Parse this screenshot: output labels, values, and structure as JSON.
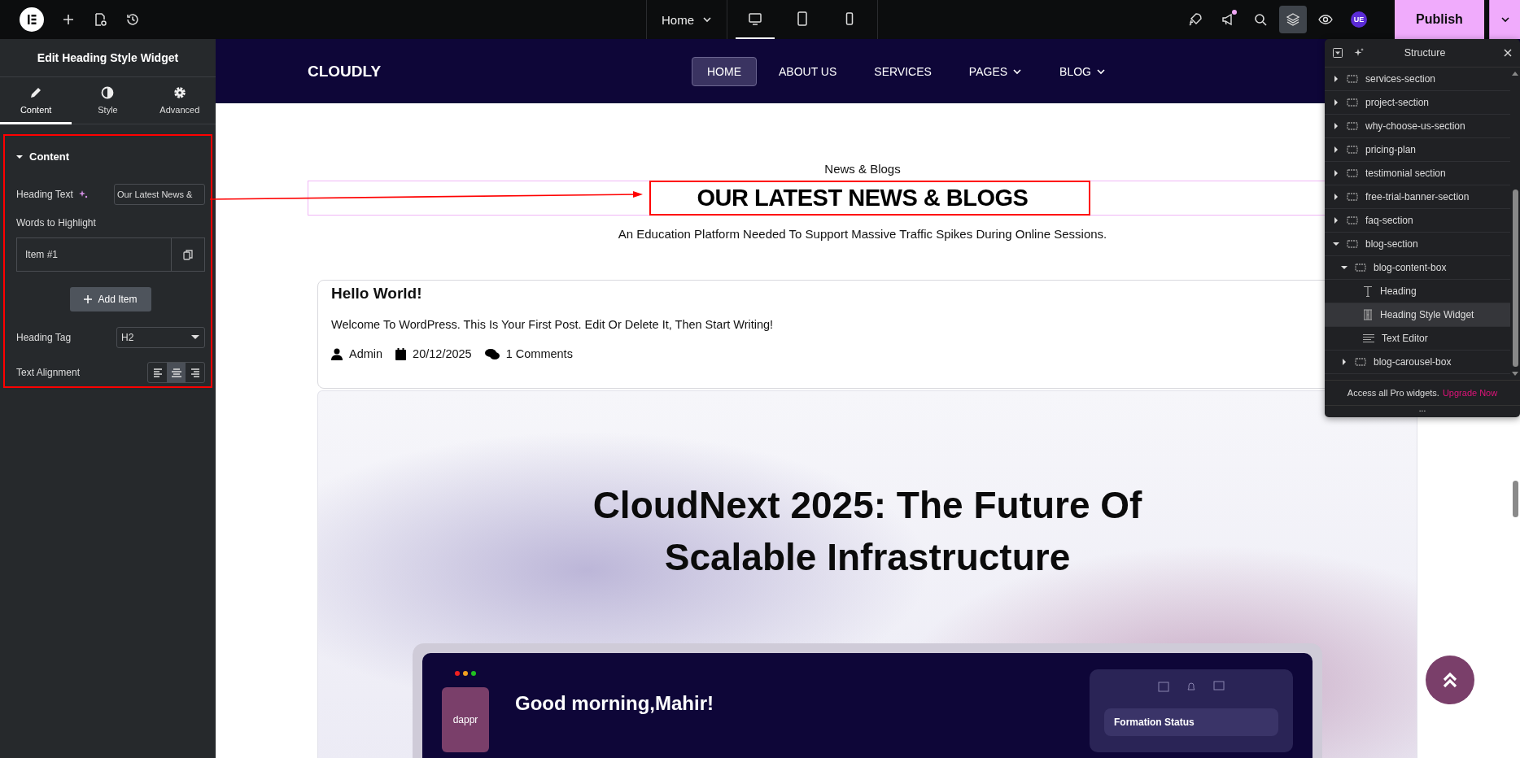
{
  "topbar": {
    "page_selector": "Home",
    "devices": [
      {
        "kind": "desktop",
        "selected": true
      },
      {
        "kind": "tablet",
        "selected": false
      },
      {
        "kind": "mobile",
        "selected": false
      }
    ],
    "notification": true,
    "layers_active": true,
    "user_badge": "UE",
    "publish": "Publish"
  },
  "panel": {
    "title": "Edit Heading Style Widget",
    "tabs": [
      {
        "kind": "pencil",
        "label": "Content",
        "selected": true
      },
      {
        "kind": "contrast",
        "label": "Style",
        "selected": false
      },
      {
        "kind": "gear",
        "label": "Advanced",
        "selected": false
      }
    ],
    "section": {
      "title": "Content",
      "expanded": true
    },
    "controls": [
      {
        "kind": "text",
        "label": "Heading Text",
        "value": "Our Latest News &"
      },
      {
        "kind": "repeater",
        "label": "Words to Highlight",
        "items": [
          "Item #1"
        ]
      },
      {
        "kind": "button",
        "label": "Add Item"
      },
      {
        "kind": "select",
        "label": "Heading Tag",
        "value": "H2"
      },
      {
        "kind": "alignment",
        "label": "Text Alignment",
        "options": [
          {
            "kind": "left",
            "selected": false
          },
          {
            "kind": "center",
            "selected": true
          },
          {
            "kind": "right",
            "selected": false
          }
        ]
      }
    ]
  },
  "site": {
    "logo": "CLOUDLY",
    "nav": [
      {
        "label": "HOME",
        "selected": true,
        "dropdown": false
      },
      {
        "label": "ABOUT US",
        "selected": false,
        "dropdown": false
      },
      {
        "label": "SERVICES",
        "selected": false,
        "dropdown": false
      },
      {
        "label": "PAGES",
        "selected": false,
        "dropdown": true
      },
      {
        "label": "BLOG",
        "selected": false,
        "dropdown": true
      }
    ],
    "eyebrow": "News & Blogs",
    "heading": "OUR LATEST NEWS & BLOGS",
    "subtitle": "An Education Platform Needed To Support Massive Traffic Spikes During Online Sessions.",
    "post": {
      "title": "Hello World!",
      "excerpt": "Welcome To WordPress. This Is Your First Post. Edit Or Delete It, Then Start Writing!",
      "author": "Admin",
      "date": "20/12/2025",
      "comments": "1 Comments"
    },
    "featured_image": {
      "title": "CloudNext 2025: The Future Of Scalable Infrastructure",
      "app_logo": "dappr",
      "greeting": "Good morning,Mahir!",
      "card_title": "Formation Status"
    }
  },
  "structure": {
    "title": "Structure",
    "items": [
      {
        "name": "services-section",
        "kind": "container",
        "expanded": false,
        "selected": false
      },
      {
        "name": "project-section",
        "kind": "container",
        "expanded": false,
        "selected": false
      },
      {
        "name": "why-choose-us-section",
        "kind": "container",
        "expanded": false,
        "selected": false
      },
      {
        "name": "pricing-plan",
        "kind": "container",
        "expanded": false,
        "selected": false
      },
      {
        "name": "testimonial section",
        "kind": "container",
        "expanded": false,
        "selected": false
      },
      {
        "name": "free-trial-banner-section",
        "kind": "container",
        "expanded": false,
        "selected": false
      },
      {
        "name": "faq-section",
        "kind": "container",
        "expanded": false,
        "selected": false
      },
      {
        "name": "blog-section",
        "kind": "container",
        "expanded": true,
        "selected": false,
        "children": [
          {
            "name": "blog-content-box",
            "kind": "container",
            "expanded": true,
            "selected": false,
            "children": [
              {
                "name": "Heading",
                "kind": "heading",
                "selected": false
              },
              {
                "name": "Heading Style Widget",
                "kind": "heading-style",
                "selected": true
              },
              {
                "name": "Text Editor",
                "kind": "text-editor",
                "selected": false
              }
            ]
          },
          {
            "name": "blog-carousel-box",
            "kind": "container",
            "expanded": false,
            "selected": false
          }
        ]
      }
    ],
    "promo": "Access all Pro widgets.",
    "promo_link": "Upgrade Now",
    "handle": "..."
  }
}
